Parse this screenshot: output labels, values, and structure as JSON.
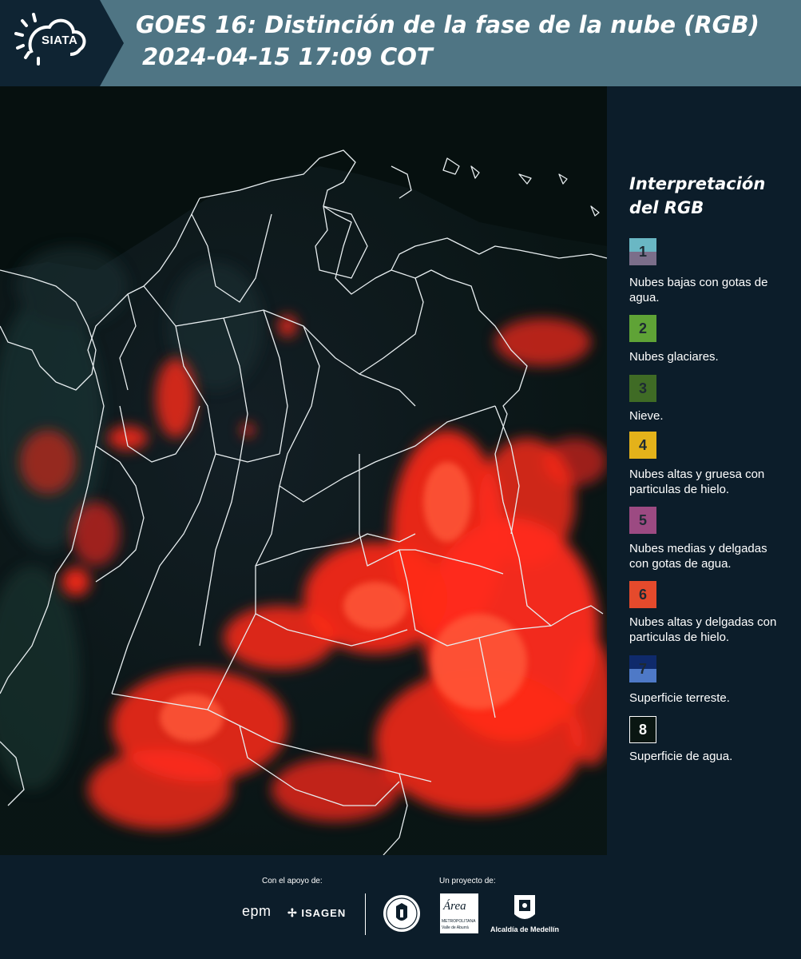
{
  "header": {
    "logo_text": "SIATA",
    "title_line1": "GOES 16: Distinción de la fase de la nube (RGB)",
    "title_line2": "2024-04-15 17:09 COT"
  },
  "legend": {
    "title": "Interpretación del RGB",
    "items": [
      {
        "num": "1",
        "label": "Nubes bajas con gotas de agua.",
        "color_top": "#6ab7c4",
        "color_bottom": "#7b6e8a"
      },
      {
        "num": "2",
        "label": "Nubes glaciares.",
        "color": "#5fa336"
      },
      {
        "num": "3",
        "label": "Nieve.",
        "color": "#3f6b25"
      },
      {
        "num": "4",
        "label": "Nubes altas y gruesa con particulas de hielo.",
        "color": "#e4b21a"
      },
      {
        "num": "5",
        "label": "Nubes medias y delgadas con gotas de agua.",
        "color": "#9c4a82"
      },
      {
        "num": "6",
        "label": "Nubes altas y delgadas con particulas de hielo.",
        "color": "#e54a2c"
      },
      {
        "num": "7",
        "label": "Superficie terreste.",
        "color_top": "#0f2a6b",
        "color_bottom": "#4e79c7"
      },
      {
        "num": "8",
        "label": "Superficie de agua.",
        "color": "#0a1612"
      }
    ]
  },
  "footer": {
    "support_label": "Con el apoyo de:",
    "project_label": "Un proyecto de:",
    "sponsor_epm": "epm",
    "sponsor_isagen": "ISAGEN",
    "partner_area": "Área",
    "partner_area_sub": "METROPOLITANA",
    "partner_area_sub2": "Valle de Aburrá",
    "partner_alcaldia": "Alcaldía de Medellín"
  }
}
